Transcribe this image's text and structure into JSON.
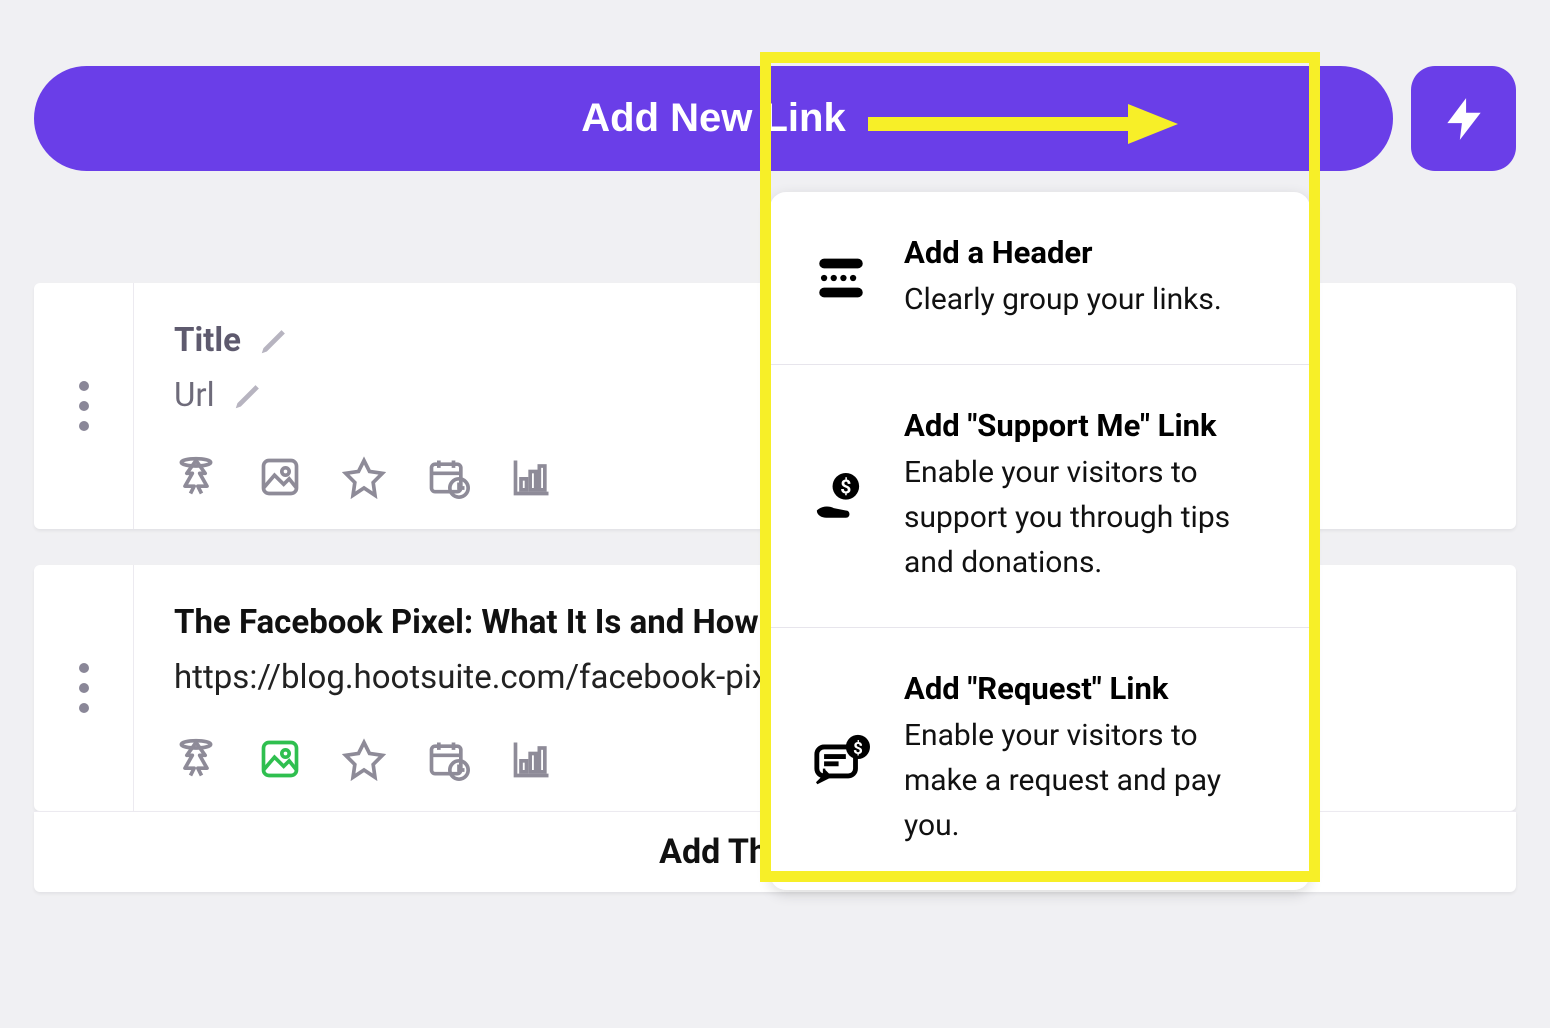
{
  "top": {
    "add_link_label": "Add New Link"
  },
  "cards": [
    {
      "title": "Title",
      "url": "Url",
      "filled": false,
      "thumb_green": false
    },
    {
      "title": "The Facebook Pixel: What It Is and How to Use It",
      "url": "https://blog.hootsuite.com/facebook-pixel/",
      "filled": true,
      "thumb_green": true
    }
  ],
  "thumb_bar": "Add Thumbnail",
  "dropdown": [
    {
      "title": "Add a Header",
      "desc": "Clearly group your links."
    },
    {
      "title": "Add \"Support Me\" Link",
      "desc": "Enable your visitors to support you through tips and donations."
    },
    {
      "title": "Add \"Request\" Link",
      "desc": "Enable your visitors to make a request and pay you."
    }
  ]
}
